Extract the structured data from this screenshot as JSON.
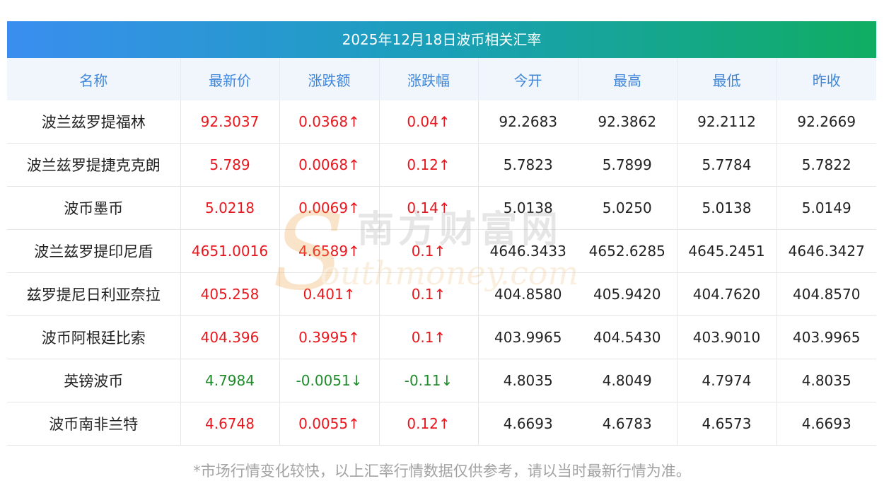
{
  "title": "2025年12月18日波币相关汇率",
  "columns": [
    "名称",
    "最新价",
    "涨跌额",
    "涨跌幅",
    "今开",
    "最高",
    "最低",
    "昨收"
  ],
  "rows": [
    {
      "name": "波兰兹罗提福林",
      "latest": "92.3037",
      "change": "0.0368↑",
      "pct": "0.04↑",
      "open": "92.2683",
      "high": "92.3862",
      "low": "92.2112",
      "prev": "92.2669",
      "dir": "up"
    },
    {
      "name": "波兰兹罗提捷克克朗",
      "latest": "5.789",
      "change": "0.0068↑",
      "pct": "0.12↑",
      "open": "5.7823",
      "high": "5.7899",
      "low": "5.7784",
      "prev": "5.7822",
      "dir": "up"
    },
    {
      "name": "波币墨币",
      "latest": "5.0218",
      "change": "0.0069↑",
      "pct": "0.14↑",
      "open": "5.0138",
      "high": "5.0250",
      "low": "5.0138",
      "prev": "5.0149",
      "dir": "up"
    },
    {
      "name": "波兰兹罗提印尼盾",
      "latest": "4651.0016",
      "change": "4.6589↑",
      "pct": "0.1↑",
      "open": "4646.3433",
      "high": "4652.6285",
      "low": "4645.2451",
      "prev": "4646.3427",
      "dir": "up"
    },
    {
      "name": "兹罗提尼日利亚奈拉",
      "latest": "405.258",
      "change": "0.401↑",
      "pct": "0.1↑",
      "open": "404.8580",
      "high": "405.9420",
      "low": "404.7620",
      "prev": "404.8570",
      "dir": "up"
    },
    {
      "name": "波币阿根廷比索",
      "latest": "404.396",
      "change": "0.3995↑",
      "pct": "0.1↑",
      "open": "403.9965",
      "high": "404.5430",
      "low": "403.9010",
      "prev": "403.9965",
      "dir": "up"
    },
    {
      "name": "英镑波币",
      "latest": "4.7984",
      "change": "-0.0051↓",
      "pct": "-0.11↓",
      "open": "4.8035",
      "high": "4.8049",
      "low": "4.7974",
      "prev": "4.8035",
      "dir": "down"
    },
    {
      "name": "波币南非兰特",
      "latest": "4.6748",
      "change": "0.0055↑",
      "pct": "0.12↑",
      "open": "4.6693",
      "high": "4.6783",
      "low": "4.6573",
      "prev": "4.6693",
      "dir": "up"
    }
  ],
  "footer": "*市场行情变化较快，以上汇率行情数据仅供参考，请以当时最新行情为准。",
  "watermark": {
    "cn": "南方财富网",
    "en": "outhmoney.com",
    "letter": "S"
  },
  "colors": {
    "up": "#e8161d",
    "down": "#1e8c2a",
    "header_text": "#3f86d9",
    "header_bg": "#f1f6fd",
    "title_from": "#3a8ef0",
    "title_to": "#10ad62"
  }
}
